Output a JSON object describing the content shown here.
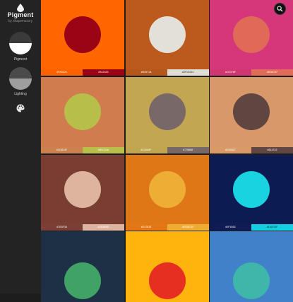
{
  "app": {
    "title": "Pigment",
    "subtitle": "by ShapeFactory",
    "modes": [
      {
        "label": "Pigment",
        "icon": "pigment-mode-icon"
      },
      {
        "label": "Lighting",
        "icon": "lighting-mode-icon"
      }
    ],
    "palette_icon": "palette-icon",
    "search_icon": "search-icon"
  },
  "swatches": [
    {
      "bg": "#FF6600",
      "dot": "#9A0415",
      "codes": [
        "#FA6200",
        "#9A0415"
      ],
      "chip_bg": [
        "#FA6200",
        "#9A0415"
      ],
      "chip_fg": [
        "#ffffff",
        "#ffffff"
      ]
    },
    {
      "bg": "#BB5A1C",
      "dot": "#E2E0D9",
      "codes": [
        "#B3571B",
        "#DFDDD4"
      ],
      "chip_bg": [
        "#B3571B",
        "#DFDDD4"
      ],
      "chip_fg": [
        "#ffffff",
        "#333333"
      ]
    },
    {
      "bg": "#D5377A",
      "dot": "#E06A57",
      "codes": [
        "#CE376F",
        "#E06C57"
      ],
      "chip_bg": [
        "#CE376F",
        "#E06C57"
      ],
      "chip_fg": [
        "#ffffff",
        "#ffffff"
      ]
    },
    {
      "bg": "#D17C4E",
      "dot": "#B7BE4A",
      "codes": [
        "#CD814F",
        "#B9C04A"
      ],
      "chip_bg": [
        "#CD814F",
        "#B9C04A"
      ],
      "chip_fg": [
        "#ffffff",
        "#ffffff"
      ]
    },
    {
      "bg": "#C2A652",
      "dot": "#786968",
      "codes": [
        "#C2A64F",
        "#776868"
      ],
      "chip_bg": [
        "#C2A64F",
        "#776868"
      ],
      "chip_fg": [
        "#ffffff",
        "#ffffff"
      ]
    },
    {
      "bg": "#D9986A",
      "dot": "#5F4641",
      "codes": [
        "#D99A67",
        "#614742"
      ],
      "chip_bg": [
        "#D99A67",
        "#614742"
      ],
      "chip_fg": [
        "#ffffff",
        "#ffffff"
      ]
    },
    {
      "bg": "#7A3D31",
      "dot": "#DDB59E",
      "codes": [
        "#7B3F35",
        "#DDB59E"
      ],
      "chip_bg": [
        "#7B3F35",
        "#DDB59E"
      ],
      "chip_fg": [
        "#ffffff",
        "#ffffff"
      ]
    },
    {
      "bg": "#E07717",
      "dot": "#EEAE36",
      "codes": [
        "#E37815",
        "#EEAE34"
      ],
      "chip_bg": [
        "#E37815",
        "#EEAE34"
      ],
      "chip_fg": [
        "#ffffff",
        "#ffffff"
      ]
    },
    {
      "bg": "#0C1B52",
      "dot": "#19D3E1",
      "codes": [
        "#0F1B52",
        "#14CFDF"
      ],
      "chip_bg": [
        "#0F1B52",
        "#14CFDF"
      ],
      "chip_fg": [
        "#ffffff",
        "#1a1a1a"
      ]
    },
    {
      "bg": "#1E3045",
      "dot": "#41A265",
      "codes": [
        "",
        ""
      ],
      "chip_bg": [
        "#1E3045",
        "#41A265"
      ],
      "chip_fg": [
        "#ffffff",
        "#ffffff"
      ]
    },
    {
      "bg": "#FFB30D",
      "dot": "#E72F21",
      "codes": [
        "",
        ""
      ],
      "chip_bg": [
        "#FFB30D",
        "#E72F21"
      ],
      "chip_fg": [
        "#ffffff",
        "#ffffff"
      ]
    },
    {
      "bg": "#4081C9",
      "dot": "#3FB6AA",
      "codes": [
        "",
        ""
      ],
      "chip_bg": [
        "#4081C9",
        "#3FB6AA"
      ],
      "chip_fg": [
        "#ffffff",
        "#ffffff"
      ]
    }
  ]
}
